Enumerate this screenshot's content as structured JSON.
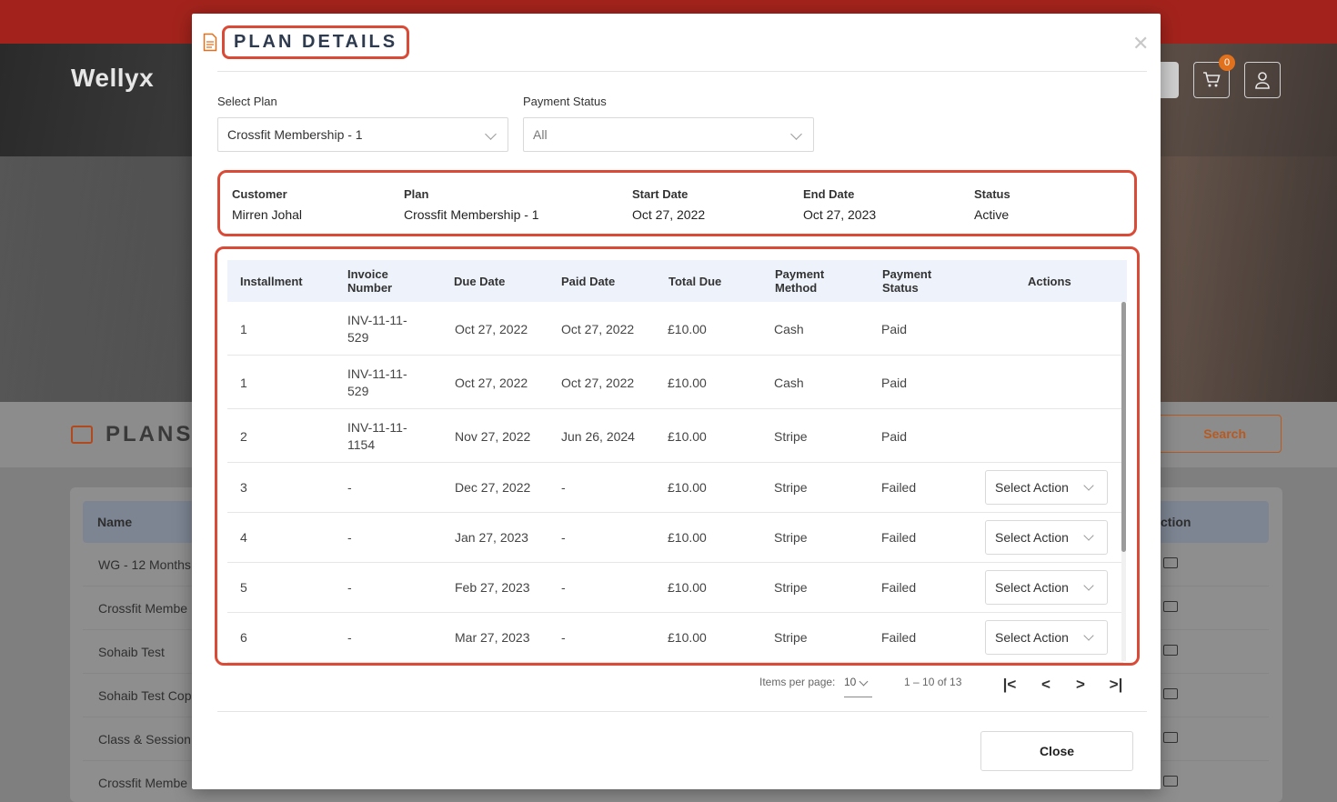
{
  "background": {
    "logo": "Wellyx",
    "cart_count": "0",
    "section_title": "PLANS",
    "search_label": "Search",
    "table_headers": {
      "name": "Name",
      "action": "ction"
    },
    "rows": [
      "WG - 12 Months",
      "Crossfit Membe",
      "Sohaib Test",
      "Sohaib Test Cop",
      "Class & Session",
      "Crossfit Membe"
    ]
  },
  "modal": {
    "title": "PLAN DETAILS",
    "select_plan_label": "Select Plan",
    "select_plan_value": "Crossfit Membership - 1",
    "payment_status_label": "Payment Status",
    "payment_status_value": "All",
    "summary": {
      "customer_label": "Customer",
      "customer": "Mirren Johal",
      "plan_label": "Plan",
      "plan": "Crossfit Membership - 1",
      "start_label": "Start Date",
      "start": "Oct 27, 2022",
      "end_label": "End Date",
      "end": "Oct 27, 2023",
      "status_label": "Status",
      "status": "Active"
    },
    "table": {
      "headers": {
        "installment": "Installment",
        "invoice_1": "Invoice",
        "invoice_2": "Number",
        "due_date": "Due Date",
        "paid_date": "Paid Date",
        "total_due": "Total Due",
        "method_1": "Payment",
        "method_2": "Method",
        "status_1": "Payment",
        "status_2": "Status",
        "actions": "Actions"
      },
      "rows": [
        {
          "installment": "1",
          "invoice_1": "INV-11-11-",
          "invoice_2": "529",
          "due": "Oct 27, 2022",
          "paid": "Oct 27, 2022",
          "total": "£10.00",
          "method": "Cash",
          "status": "Paid",
          "action": ""
        },
        {
          "installment": "1",
          "invoice_1": "INV-11-11-",
          "invoice_2": "529",
          "due": "Oct 27, 2022",
          "paid": "Oct 27, 2022",
          "total": "£10.00",
          "method": "Cash",
          "status": "Paid",
          "action": ""
        },
        {
          "installment": "2",
          "invoice_1": "INV-11-11-",
          "invoice_2": "1154",
          "due": "Nov 27, 2022",
          "paid": "Jun 26, 2024",
          "total": "£10.00",
          "method": "Stripe",
          "status": "Paid",
          "action": ""
        },
        {
          "installment": "3",
          "invoice_1": "-",
          "invoice_2": "",
          "due": "Dec 27, 2022",
          "paid": "-",
          "total": "£10.00",
          "method": "Stripe",
          "status": "Failed",
          "action": "Select Action"
        },
        {
          "installment": "4",
          "invoice_1": "-",
          "invoice_2": "",
          "due": "Jan 27, 2023",
          "paid": "-",
          "total": "£10.00",
          "method": "Stripe",
          "status": "Failed",
          "action": "Select Action"
        },
        {
          "installment": "5",
          "invoice_1": "-",
          "invoice_2": "",
          "due": "Feb 27, 2023",
          "paid": "-",
          "total": "£10.00",
          "method": "Stripe",
          "status": "Failed",
          "action": "Select Action"
        },
        {
          "installment": "6",
          "invoice_1": "-",
          "invoice_2": "",
          "due": "Mar 27, 2023",
          "paid": "-",
          "total": "£10.00",
          "method": "Stripe",
          "status": "Failed",
          "action": "Select Action"
        }
      ]
    },
    "pagination": {
      "items_per_page_label": "Items per page:",
      "page_size": "10",
      "range": "1 – 10 of 13",
      "first": "|<",
      "prev": "<",
      "next": ">",
      "last": ">|"
    },
    "close_label": "Close"
  },
  "colors": {
    "highlight": "#d94b36",
    "brand_red": "#a3231c",
    "accent_orange": "#e2711d"
  }
}
